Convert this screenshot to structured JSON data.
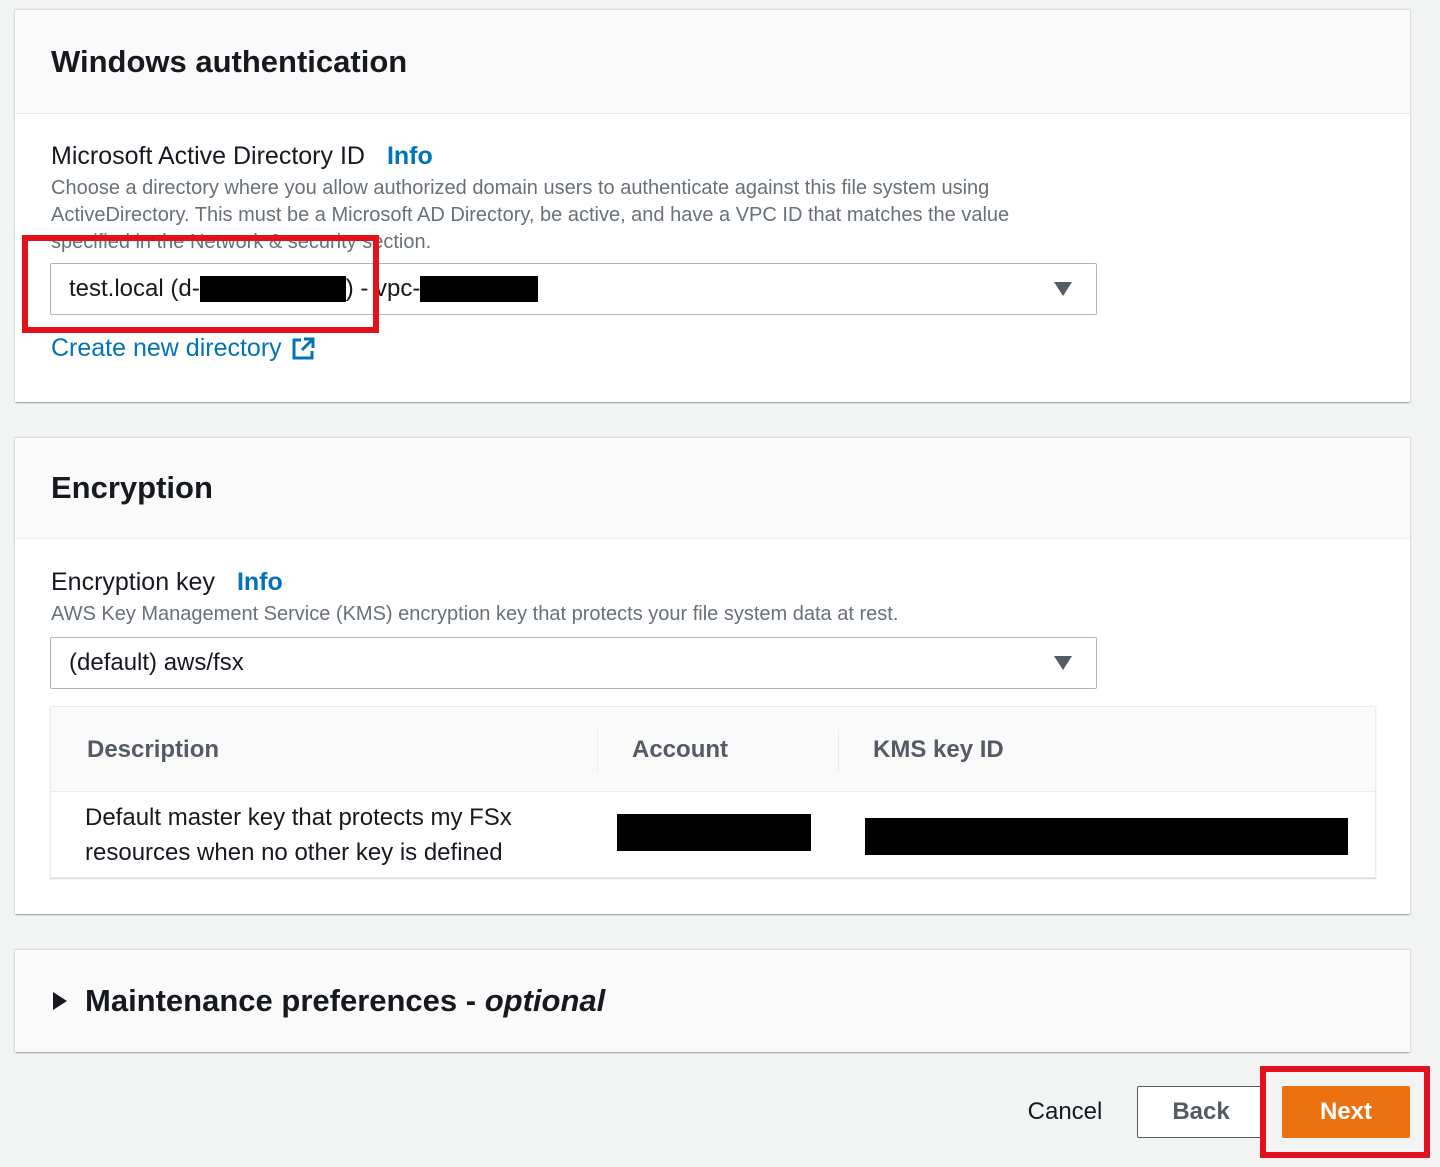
{
  "auth": {
    "title": "Windows authentication",
    "field_label": "Microsoft Active Directory ID",
    "info": "Info",
    "description": "Choose a directory where you allow authorized domain users to authenticate against this file system using ActiveDirectory. This must be a Microsoft AD Directory, be active, and have a VPC ID that matches the value specified in the Network & security section.",
    "select_prefix": "test.local (d-",
    "select_middle": ") - vpc-",
    "create_link": "Create new directory"
  },
  "encryption": {
    "title": "Encryption",
    "field_label": "Encryption key",
    "info": "Info",
    "description": "AWS Key Management Service (KMS) encryption key that protects your file system data at rest.",
    "select_value": "(default) aws/fsx",
    "table": {
      "headers": [
        "Description",
        "Account",
        "KMS key ID"
      ],
      "row": {
        "description": "Default master key that protects my FSx resources when no other key is defined"
      }
    }
  },
  "maintenance": {
    "title": "Maintenance preferences - ",
    "optional": "optional"
  },
  "footer": {
    "cancel": "Cancel",
    "back": "Back",
    "next": "Next"
  },
  "colors": {
    "primary_button": "#ec7211",
    "link": "#0073bb",
    "highlight": "#e4111b"
  },
  "icons": {
    "external_link": "external-link-icon",
    "dropdown": "caret-down-icon",
    "expand": "caret-right-icon"
  }
}
